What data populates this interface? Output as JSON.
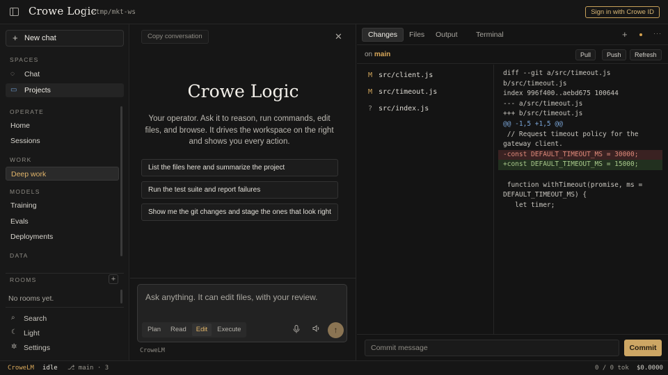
{
  "topbar": {
    "brand": "Crowe Logic",
    "path": "/tmp/mkt-ws",
    "signin": "Sign in with Crowe ID"
  },
  "sidebar": {
    "new_chat": "New chat",
    "sections": {
      "spaces": "SPACES",
      "operate": "OPERATE",
      "work": "WORK",
      "models": "MODELS",
      "data": "DATA",
      "rooms": "ROOMS"
    },
    "spaces_items": [
      "Chat",
      "Projects"
    ],
    "operate_items": [
      "Home",
      "Sessions"
    ],
    "work_items": [
      "Deep work"
    ],
    "models_items": [
      "Training",
      "Evals",
      "Deployments"
    ],
    "rooms_empty": "No rooms yet.",
    "footer": [
      "Search",
      "Light",
      "Settings"
    ]
  },
  "chat": {
    "copy_conversation": "Copy conversation",
    "hero": "Crowe Logic",
    "intro": "Your operator. Ask it to reason, run commands, edit files, and browse. It drives the workspace on the right and shows you every action.",
    "suggestions": [
      "List the files here and summarize the project",
      "Run the test suite and report failures",
      "Show me the git changes and stage the ones that look right"
    ],
    "placeholder": "Ask anything. It can edit files, with your review.",
    "modes": [
      "Plan",
      "Read",
      "Edit",
      "Execute"
    ],
    "active_mode": "Edit",
    "model": "CroweLM"
  },
  "panel": {
    "tabs": [
      "Changes",
      "Files",
      "Output",
      "Terminal"
    ],
    "active_tab": "Changes",
    "branch_prefix": "on",
    "branch": "main",
    "buttons": [
      "Pull",
      "Push",
      "Refresh"
    ],
    "files": [
      {
        "status": "M",
        "path": "src/client.js"
      },
      {
        "status": "M",
        "path": "src/timeout.js"
      },
      {
        "status": "?",
        "path": "src/index.js"
      }
    ],
    "diff_lines": [
      {
        "kind": "meta",
        "text": "diff --git a/src/timeout.js"
      },
      {
        "kind": "meta",
        "text": "b/src/timeout.js"
      },
      {
        "kind": "meta",
        "text": "index 996f400..aebd675 100644"
      },
      {
        "kind": "meta",
        "text": "--- a/src/timeout.js"
      },
      {
        "kind": "meta",
        "text": "+++ b/src/timeout.js"
      },
      {
        "kind": "hunk",
        "text": "@@ -1,5 +1,5 @@"
      },
      {
        "kind": "ctx",
        "text": " // Request timeout policy for the"
      },
      {
        "kind": "ctx",
        "text": "gateway client."
      },
      {
        "kind": "del",
        "text": "-const DEFAULT_TIMEOUT_MS = 30000;"
      },
      {
        "kind": "add",
        "text": "+const DEFAULT_TIMEOUT_MS = 15000;"
      },
      {
        "kind": "ctx",
        "text": ""
      },
      {
        "kind": "ctx",
        "text": " function withTimeout(promise, ms ="
      },
      {
        "kind": "ctx",
        "text": "DEFAULT_TIMEOUT_MS) {"
      },
      {
        "kind": "ctx",
        "text": "   let timer;"
      }
    ],
    "commit_placeholder": "Commit message",
    "commit_button": "Commit"
  },
  "statusbar": {
    "model": "CroweLM",
    "state": "idle",
    "branch_info": "⎇ main · 3",
    "tokens": "0 / 0 tok",
    "cost": "$0.0000"
  },
  "colors": {
    "accent": "#d9a85a",
    "commit_button": "#cda664",
    "diff_add": "#a8c98b",
    "diff_del": "#e08a7a"
  }
}
